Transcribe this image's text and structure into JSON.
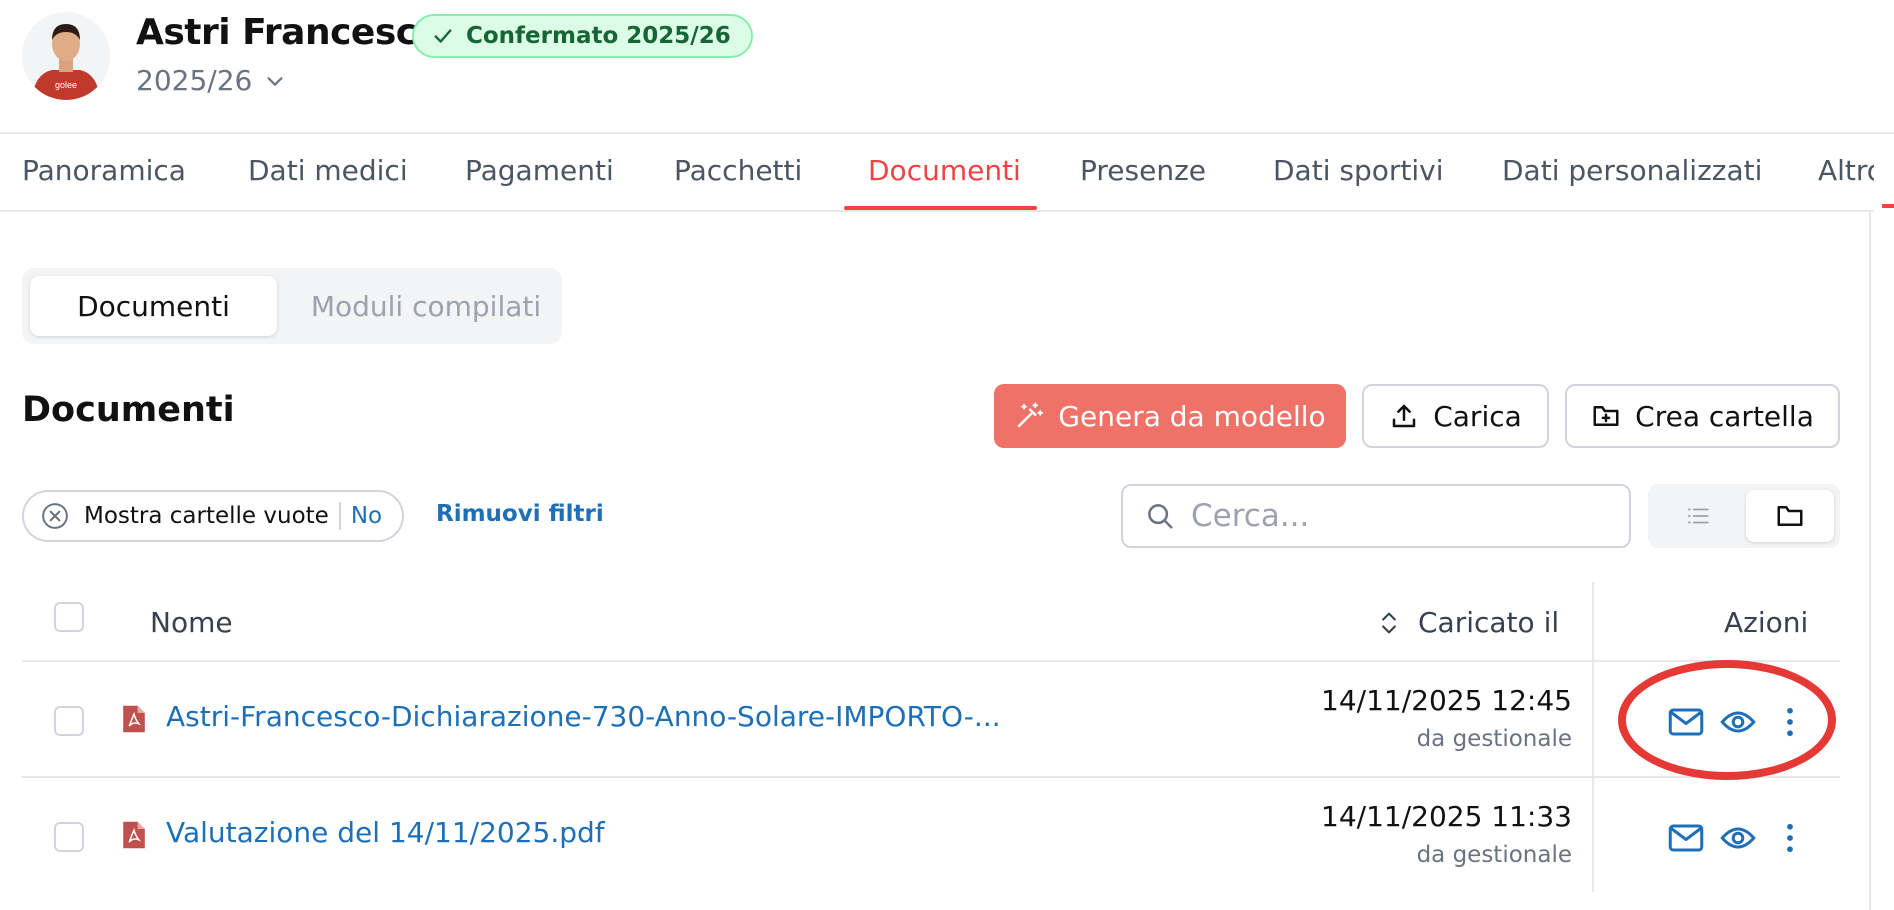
{
  "header": {
    "name": "Astri Francesco",
    "badge": "Confermato 2025/26",
    "season": "2025/26",
    "avatar_shirt_text": "golee"
  },
  "tabs": [
    {
      "label": "Panoramica"
    },
    {
      "label": "Dati medici"
    },
    {
      "label": "Pagamenti"
    },
    {
      "label": "Pacchetti"
    },
    {
      "label": "Documenti",
      "active": true
    },
    {
      "label": "Presenze"
    },
    {
      "label": "Dati sportivi"
    },
    {
      "label": "Dati personalizzati"
    },
    {
      "label": "Altro"
    }
  ],
  "segmented": {
    "documents": "Documenti",
    "forms": "Moduli compilati"
  },
  "section": {
    "title": "Documenti",
    "generate_label": "Genera da modello",
    "upload_label": "Carica",
    "create_folder_label": "Crea cartella"
  },
  "filters": {
    "empty_folders_label": "Mostra cartelle vuote",
    "empty_folders_value": "No",
    "remove_filters": "Rimuovi filtri",
    "search_placeholder": "Cerca..."
  },
  "table": {
    "columns": {
      "name": "Nome",
      "uploaded": "Caricato il",
      "actions": "Azioni"
    },
    "rows": [
      {
        "name": "Astri-Francesco-Dichiarazione-730-Anno-Solare-IMPORTO-...",
        "date": "14/11/2025 12:45",
        "source": "da gestionale"
      },
      {
        "name": "Valutazione del 14/11/2025.pdf",
        "date": "14/11/2025 11:33",
        "source": "da gestionale"
      }
    ]
  },
  "colors": {
    "accent": "#ef4444",
    "primary_button": "#f07167",
    "link": "#1d6fb8",
    "badge_bg": "#dcfce7",
    "badge_text": "#166534",
    "annotation": "#e53935"
  }
}
